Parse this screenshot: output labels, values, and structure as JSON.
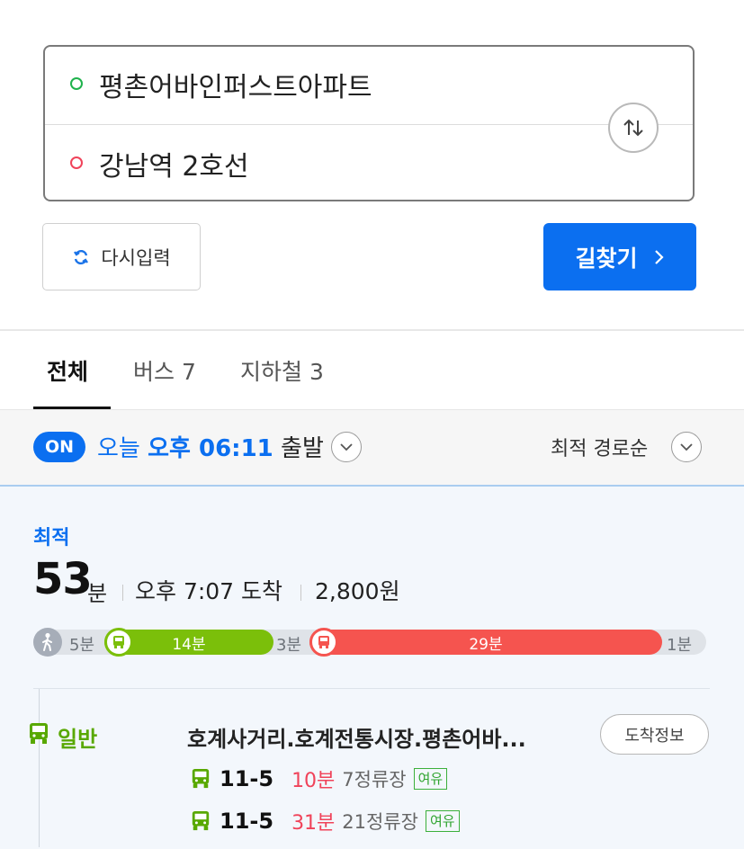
{
  "route": {
    "origin": "평촌어바인퍼스트아파트",
    "destination": "강남역 2호선"
  },
  "buttons": {
    "reset_label": "다시입력",
    "search_label": "길찾기"
  },
  "tabs": [
    {
      "label": "전체",
      "active": true
    },
    {
      "label": "버스 7",
      "active": false
    },
    {
      "label": "지하철 3",
      "active": false
    }
  ],
  "time_filter": {
    "on_badge": "ON",
    "day": "오늘",
    "time": "오후 06:11",
    "suffix": "출발",
    "sort_label": "최적 경로순"
  },
  "result": {
    "badge": "최적",
    "duration_value": "53",
    "duration_unit": "분",
    "arrival": "오후 7:07 도착",
    "fare": "2,800원",
    "segments": [
      {
        "type": "walk",
        "minutes": "5분"
      },
      {
        "type": "bus",
        "minutes": "14분",
        "color": "#7bbf0a"
      },
      {
        "type": "transfer",
        "minutes": "3분"
      },
      {
        "type": "bus",
        "minutes": "29분",
        "color": "#f5544f"
      },
      {
        "type": "walk",
        "minutes": "1분"
      }
    ],
    "leg": {
      "bus_type": "일반",
      "stop_name": "호계사거리.호계전통시장.평촌어바...",
      "arrival_info_label": "도착정보",
      "buses": [
        {
          "number": "11-5",
          "eta": "10분",
          "stops": "7정류장",
          "crowd": "여유"
        },
        {
          "number": "11-5",
          "eta": "31분",
          "stops": "21정류장",
          "crowd": "여유"
        }
      ]
    }
  },
  "colors": {
    "accent_blue": "#0b6ff0",
    "bus_green": "#7bbf0a",
    "bus_red": "#f5544f",
    "origin_dot": "#1fb24c",
    "destination_dot": "#f0435a"
  }
}
